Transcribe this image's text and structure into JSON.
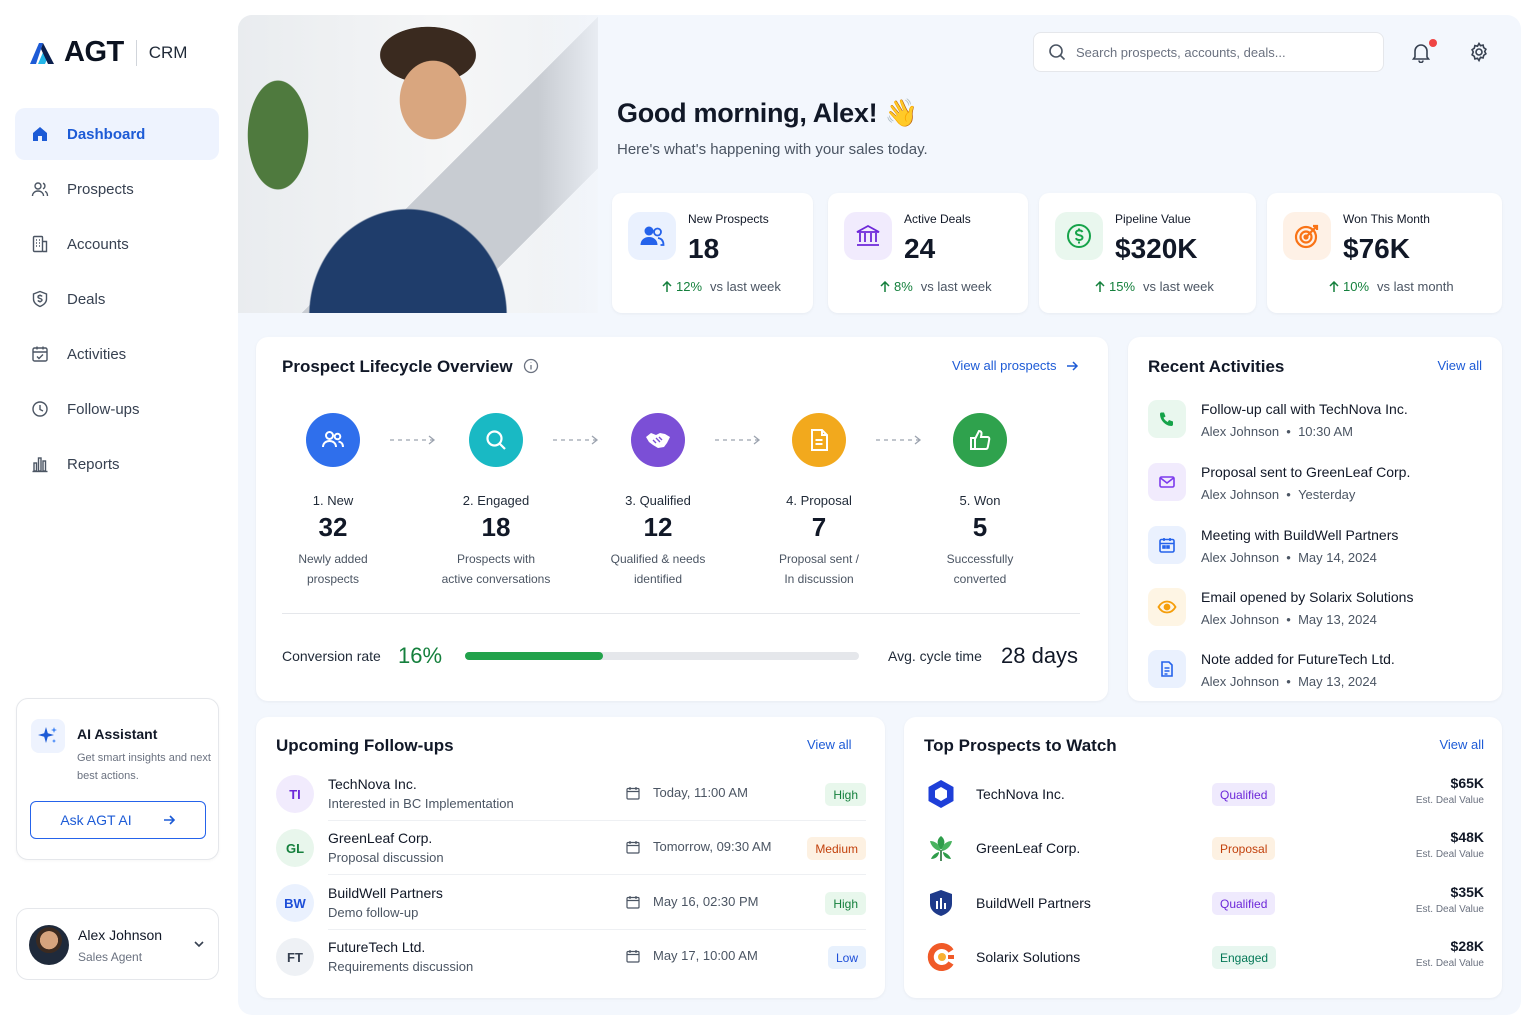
{
  "brand": {
    "name": "AGT",
    "product": "CRM"
  },
  "nav": {
    "items": [
      {
        "label": "Dashboard",
        "icon": "home-icon",
        "active": true
      },
      {
        "label": "Prospects",
        "icon": "users-icon"
      },
      {
        "label": "Accounts",
        "icon": "building-icon"
      },
      {
        "label": "Deals",
        "icon": "dollar-shield-icon"
      },
      {
        "label": "Activities",
        "icon": "calendar-check-icon"
      },
      {
        "label": "Follow-ups",
        "icon": "clock-icon"
      },
      {
        "label": "Reports",
        "icon": "bar-chart-icon"
      }
    ]
  },
  "ai": {
    "title": "AI Assistant",
    "desc": "Get smart insights and next best actions.",
    "button": "Ask AGT AI"
  },
  "user": {
    "name": "Alex Johnson",
    "role": "Sales Agent"
  },
  "search": {
    "placeholder": "Search prospects, accounts, deals..."
  },
  "greeting": {
    "title": "Good morning, Alex! 👋",
    "subtitle": "Here's what's happening with your sales today."
  },
  "stats": [
    {
      "label": "New Prospects",
      "value": "18",
      "delta": "12%",
      "period": "vs last week",
      "color": "#2563eb"
    },
    {
      "label": "Active Deals",
      "value": "24",
      "delta": "8%",
      "period": "vs last week",
      "color": "#6d28d9"
    },
    {
      "label": "Pipeline Value",
      "value": "$320K",
      "delta": "15%",
      "period": "vs last week",
      "color": "#16a34a"
    },
    {
      "label": "Won This Month",
      "value": "$76K",
      "delta": "10%",
      "period": "vs last month",
      "color": "#f97316"
    }
  ],
  "lifecycle": {
    "title": "Prospect Lifecycle Overview",
    "link": "View all prospects",
    "stages": [
      {
        "name": "1. New",
        "count": "32",
        "desc1": "Newly added",
        "desc2": "prospects",
        "color": "#2f6fec"
      },
      {
        "name": "2. Engaged",
        "count": "18",
        "desc1": "Prospects with",
        "desc2": "active conversations",
        "color": "#19b9c4"
      },
      {
        "name": "3. Qualified",
        "count": "12",
        "desc1": "Qualified & needs",
        "desc2": "identified",
        "color": "#7b4fd6"
      },
      {
        "name": "4. Proposal",
        "count": "7",
        "desc1": "Proposal sent /",
        "desc2": "In discussion",
        "color": "#f2a91d"
      },
      {
        "name": "5. Won",
        "count": "5",
        "desc1": "Successfully",
        "desc2": "converted",
        "color": "#2fa24d"
      }
    ],
    "conversion_label": "Conversion rate",
    "conversion_value": "16%",
    "conversion_fraction": 0.35,
    "cycle_label": "Avg. cycle time",
    "cycle_value": "28 days"
  },
  "activities": {
    "title": "Recent Activities",
    "link": "View all",
    "items": [
      {
        "title": "Follow-up call with TechNova Inc.",
        "who": "Alex Johnson",
        "when": "10:30 AM",
        "icon": "phone-icon",
        "color": "#16a34a",
        "bg": "#e9f7ee"
      },
      {
        "title": "Proposal sent to GreenLeaf Corp.",
        "who": "Alex Johnson",
        "when": "Yesterday",
        "icon": "mail-icon",
        "color": "#7c3aed",
        "bg": "#f1ebfd"
      },
      {
        "title": "Meeting with BuildWell Partners",
        "who": "Alex Johnson",
        "when": "May 14, 2024",
        "icon": "calendar-icon",
        "color": "#2563eb",
        "bg": "#eaf1fe"
      },
      {
        "title": "Email opened by Solarix Solutions",
        "who": "Alex Johnson",
        "when": "May 13, 2024",
        "icon": "eye-icon",
        "color": "#f59e0b",
        "bg": "#fef5e4"
      },
      {
        "title": "Note added for FutureTech Ltd.",
        "who": "Alex Johnson",
        "when": "May 13, 2024",
        "icon": "note-icon",
        "color": "#2563eb",
        "bg": "#eaf1fe"
      }
    ]
  },
  "followups": {
    "title": "Upcoming Follow-ups",
    "link": "View all",
    "items": [
      {
        "initials": "TI",
        "name": "TechNova Inc.",
        "desc": "Interested in BC Implementation",
        "date": "Today, 11:00 AM",
        "priority": "High",
        "avbg": "#f1ebfd",
        "avfg": "#6d28d9",
        "bbg": "#e8f7ec",
        "bfg": "#15803d"
      },
      {
        "initials": "GL",
        "name": "GreenLeaf Corp.",
        "desc": "Proposal discussion",
        "date": "Tomorrow, 09:30 AM",
        "priority": "Medium",
        "avbg": "#e8f6ec",
        "avfg": "#15803d",
        "bbg": "#fdf1e2",
        "bfg": "#c2410c"
      },
      {
        "initials": "BW",
        "name": "BuildWell Partners",
        "desc": "Demo follow-up",
        "date": "May 16, 02:30 PM",
        "priority": "High",
        "avbg": "#eaf1fe",
        "avfg": "#1d4ed8",
        "bbg": "#e8f7ec",
        "bfg": "#15803d"
      },
      {
        "initials": "FT",
        "name": "FutureTech Ltd.",
        "desc": "Requirements discussion",
        "date": "May 17, 10:00 AM",
        "priority": "Low",
        "avbg": "#eef1f5",
        "avfg": "#374151",
        "bbg": "#e8f1fd",
        "bfg": "#1d4ed8"
      }
    ]
  },
  "top": {
    "title": "Top Prospects to Watch",
    "link": "View all",
    "est_label": "Est. Deal Value",
    "items": [
      {
        "name": "TechNova Inc.",
        "stage": "Qualified",
        "value": "$65K",
        "logo": "hexagon-logo-icon",
        "bbg": "#efeafd",
        "bfg": "#6d28d9"
      },
      {
        "name": "GreenLeaf Corp.",
        "stage": "Proposal",
        "value": "$48K",
        "logo": "leaf-logo-icon",
        "bbg": "#fdf1e2",
        "bfg": "#c2410c"
      },
      {
        "name": "BuildWell Partners",
        "stage": "Qualified",
        "value": "$35K",
        "logo": "shield-logo-icon",
        "bbg": "#efeafd",
        "bfg": "#6d28d9"
      },
      {
        "name": "Solarix Solutions",
        "stage": "Engaged",
        "value": "$28K",
        "logo": "sun-logo-icon",
        "bbg": "#e7f6ef",
        "bfg": "#047857"
      }
    ]
  }
}
